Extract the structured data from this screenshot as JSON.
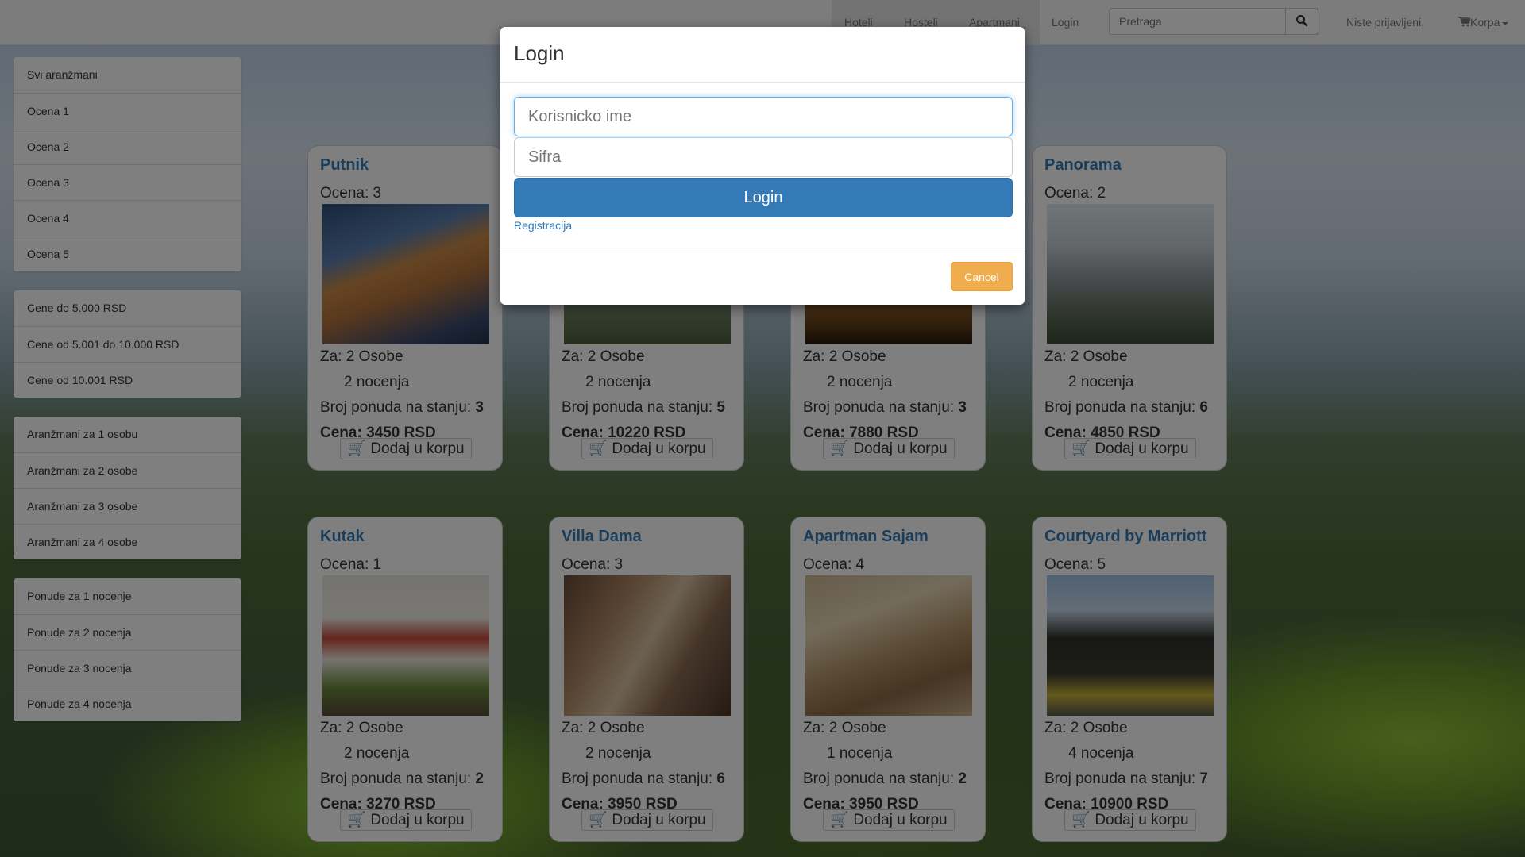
{
  "navbar": {
    "links": [
      "Hoteli",
      "Hosteli",
      "Apartmani",
      "Login"
    ],
    "search_placeholder": "Pretraga",
    "status": "Niste prijavljeni.",
    "cart": "Korpa"
  },
  "sidebar": {
    "ratings": [
      "Svi aranžmani",
      "Ocena 1",
      "Ocena 2",
      "Ocena 3",
      "Ocena 4",
      "Ocena 5"
    ],
    "prices": [
      "Cene do 5.000 RSD",
      "Cene od 5.001 do 10.000 RSD",
      "Cene od 10.001 RSD"
    ],
    "persons": [
      "Aranžmani za 1 osobu",
      "Aranžmani za 2 osobe",
      "Aranžmani za 3 osobe",
      "Aranžmani za 4 osobe"
    ],
    "nights": [
      "Ponude za 1 nocenje",
      "Ponude za 2 nocenja",
      "Ponude za 3 nocenja",
      "Ponude za 4 nocenja"
    ]
  },
  "cards": [
    {
      "title": "Putnik",
      "rating": "Ocena: 3",
      "persons": "Za: 2 Osobe",
      "nights": "2 nocenja",
      "stock_label": "Broj ponuda na stanju: ",
      "stock": "3",
      "price": "Cena: 3450 RSD",
      "button": "Dodaj u korpu"
    },
    {
      "title": "",
      "rating": "",
      "persons": "Za: 2 Osobe",
      "nights": "2 nocenja",
      "stock_label": "Broj ponuda na stanju: ",
      "stock": "5",
      "price": "Cena: 10220 RSD",
      "button": "Dodaj u korpu"
    },
    {
      "title": "",
      "rating": "",
      "persons": "Za: 2 Osobe",
      "nights": "2 nocenja",
      "stock_label": "Broj ponuda na stanju: ",
      "stock": "3",
      "price": "Cena: 7880 RSD",
      "button": "Dodaj u korpu"
    },
    {
      "title": "Panorama",
      "rating": "Ocena: 2",
      "persons": "Za: 2 Osobe",
      "nights": "2 nocenja",
      "stock_label": "Broj ponuda na stanju: ",
      "stock": "6",
      "price": "Cena: 4850 RSD",
      "button": "Dodaj u korpu"
    },
    {
      "title": "Kutak",
      "rating": "Ocena: 1",
      "persons": "Za: 2 Osobe",
      "nights": "2 nocenja",
      "stock_label": "Broj ponuda na stanju: ",
      "stock": "2",
      "price": "Cena: 3270 RSD",
      "button": "Dodaj u korpu"
    },
    {
      "title": "Villa Dama",
      "rating": "Ocena: 3",
      "persons": "Za: 2 Osobe",
      "nights": "2 nocenja",
      "stock_label": "Broj ponuda na stanju: ",
      "stock": "6",
      "price": "Cena: 3950 RSD",
      "button": "Dodaj u korpu"
    },
    {
      "title": "Apartman Sajam",
      "rating": "Ocena: 4",
      "persons": "Za: 2 Osobe",
      "nights": "1 nocenja",
      "stock_label": "Broj ponuda na stanju: ",
      "stock": "2",
      "price": "Cena: 3950 RSD",
      "button": "Dodaj u korpu"
    },
    {
      "title": "Courtyard by Marriott",
      "rating": "Ocena: 5",
      "persons": "Za: 2 Osobe",
      "nights": "4 nocenja",
      "stock_label": "Broj ponuda na stanju: ",
      "stock": "7",
      "price": "Cena: 10900 RSD",
      "button": "Dodaj u korpu"
    }
  ],
  "modal": {
    "title": "Login",
    "username_placeholder": "Korisnicko ime",
    "password_placeholder": "Sifra",
    "login_button": "Login",
    "register_link": "Registracija",
    "cancel_button": "Cancel"
  }
}
